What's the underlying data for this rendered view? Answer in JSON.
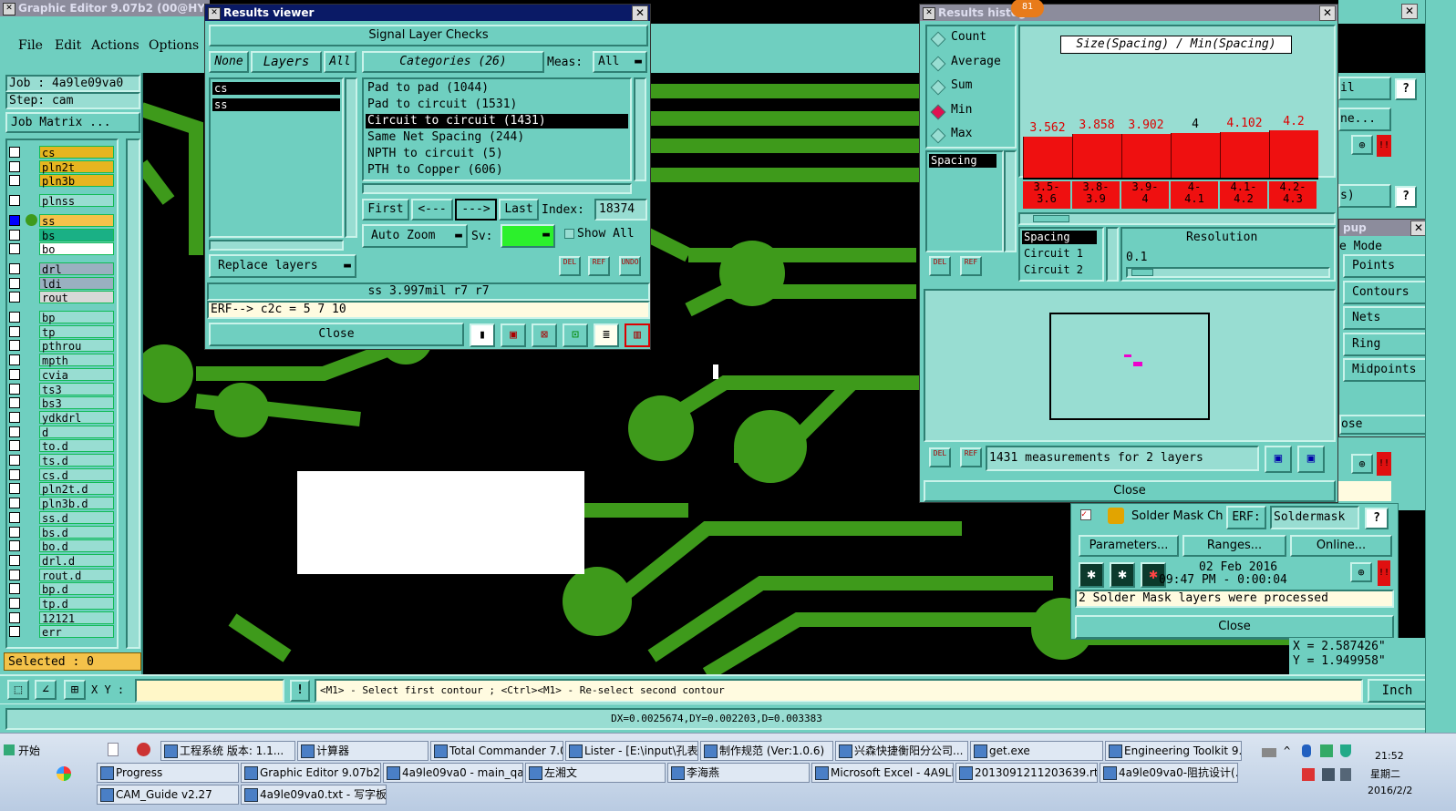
{
  "main_window": {
    "title": "Graphic Editor 9.07b2 (00@HY-HYCA",
    "menu": [
      "File",
      "Edit",
      "Actions",
      "Options"
    ],
    "job": "Job : 4a9le09va0",
    "step": "Step: cam",
    "job_matrix": "Job Matrix ...",
    "layers": [
      "cs",
      "pln2t",
      "pln3b",
      "plnss",
      "ss",
      "bs",
      "bo",
      "drl",
      "ldi",
      "rout",
      "bp",
      "tp",
      "pthrou",
      "mpth",
      "cvia",
      "ts3",
      "bs3",
      "ydkdrl",
      "d",
      "to.d",
      "ts.d",
      "cs.d",
      "pln2t.d",
      "pln3b.d",
      "ss.d",
      "bs.d",
      "bo.d",
      "drl.d",
      "rout.d",
      "bp.d",
      "tp.d",
      "12121",
      "err"
    ],
    "selected": "Selected : 0",
    "xy_label": "X Y :",
    "xy_value": "",
    "warn": "!",
    "hint": "<M1> - Select first contour ; <Ctrl><M1> - Re-select second contour",
    "status": "DX=0.0025674,DY=0.002203,D=0.003383",
    "units": "Inch",
    "coord_x": "X = 2.587426\"",
    "coord_y": "Y = 1.949958\""
  },
  "results_viewer": {
    "title": "Results viewer",
    "header": "Signal Layer Checks",
    "none": "None",
    "layers": "Layers",
    "all": "All",
    "categories_label": "Categories (26)",
    "meas_label": "Meas:",
    "meas_value": "All",
    "layer_items": [
      "cs",
      "ss"
    ],
    "categories": [
      "Pad to pad (1044)",
      "Pad to circuit (1531)",
      "Circuit to circuit (1431)",
      "Same Net Spacing (244)",
      "NPTH to circuit (5)",
      "PTH to Copper (606)"
    ],
    "selected_category": 2,
    "first": "First",
    "prev": "<---",
    "next": "--->",
    "last": "Last",
    "index_label": "Index:",
    "index_value": "18374",
    "auto_zoom": "Auto Zoom",
    "sv_label": "Sv:",
    "show_all": "Show All",
    "replace_layers": "Replace layers",
    "del": "DEL",
    "ref": "REF",
    "undo": "UNDO",
    "measurement": "ss 3.997mil  r7  r7",
    "erf": "ERF--> c2c = 5 7 10",
    "close": "Close"
  },
  "histogram": {
    "title": "Results histog",
    "badge": "81",
    "stats": [
      "Count",
      "Average",
      "Sum",
      "Min",
      "Max"
    ],
    "selected_stat": 3,
    "heading": "Size(Spacing) / Min(Spacing)",
    "field_item": "Spacing",
    "bars": [
      {
        "value": "3.562",
        "label": "3.5-\n3.6",
        "fraction": 0.86
      },
      {
        "value": "3.858",
        "label": "3.8-\n3.9",
        "fraction": 0.92
      },
      {
        "value": "3.902",
        "label": "3.9-\n4",
        "fraction": 0.92
      },
      {
        "value": "4",
        "label": "4-\n4.1",
        "fraction": 0.95
      },
      {
        "value": "4.102",
        "label": "4.1-\n4.2",
        "fraction": 0.97
      },
      {
        "value": "4.2",
        "label": "4.2-\n4.3",
        "fraction": 1.0
      }
    ],
    "sort_items": [
      "Spacing",
      "Circuit 1",
      "Circuit 2"
    ],
    "resolution_label": "Resolution",
    "resolution_value": "0.1",
    "summary": "1431 measurements for 2 layers",
    "close": "Close",
    "del": "DEL",
    "ref": "REF"
  },
  "right_panel": {
    "popup_title": "pup",
    "mode_label": "e Mode",
    "modes": [
      "Points",
      "Contours",
      "Nets",
      "Ring",
      "Midpoints"
    ],
    "close_partial": "ose",
    "il": "il",
    "ne": "ne...",
    "s": "s)",
    "question": "?",
    "excl": "!!"
  },
  "solder_mask": {
    "name": "Solder Mask Ch",
    "erf_label": "ERF:",
    "erf_value": "Soldermask",
    "parameters": "Parameters...",
    "ranges": "Ranges...",
    "online": "Online...",
    "date": "02 Feb 2016",
    "time": "09:47 PM - 0:00:04",
    "message": "2 Solder Mask layers were processed",
    "close": "Close"
  },
  "taskbar": {
    "start": "开始",
    "row1": [
      "工程系统 版本: 1.1...",
      "计算器",
      "Total Commander 7.0 ...",
      "Lister - [E:\\input\\孔表...",
      "制作规范 (Ver:1.0.6)",
      "兴森快捷衡阳分公司...",
      "get.exe",
      "Engineering Toolkit 9.0..."
    ],
    "row2": [
      "Progress",
      "Graphic Editor 9.07b2...",
      "4a9le09va0 - main_qa",
      "左湘文",
      "李海燕",
      "Microsoft Excel - 4A9LE0...",
      "2013091211203639.rtf [...",
      "4a9le09va0-阻抗设计(..."
    ],
    "row3": [
      "CAM_Guide v2.27",
      "4a9le09va0.txt - 写字板"
    ],
    "time": "21:52",
    "weekday": "星期二",
    "date": "2016/2/2"
  }
}
